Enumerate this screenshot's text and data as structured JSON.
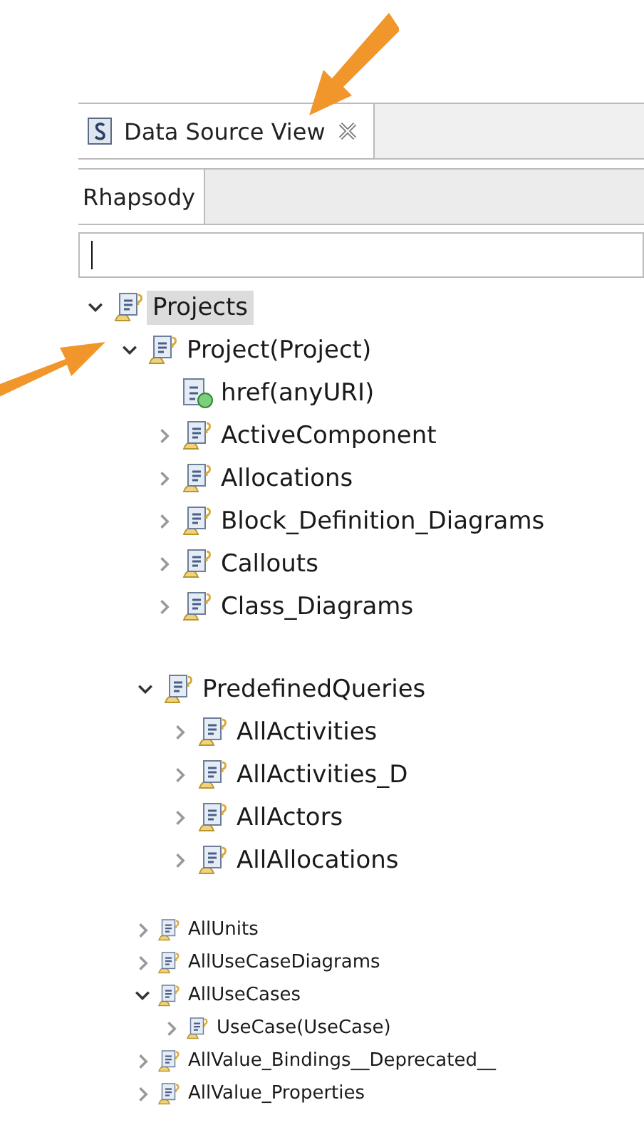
{
  "view": {
    "tabs": [
      {
        "label": "Data Source View",
        "selected": true
      }
    ],
    "subtabs": [
      {
        "label": "Rhapsody",
        "selected": true
      }
    ],
    "tree": [
      {
        "label": "Projects",
        "kind": "element",
        "expanded": true,
        "selected": true,
        "children": [
          {
            "label": "Project(Project)",
            "kind": "element",
            "expanded": true,
            "selected": false,
            "children": [
              {
                "label": "href(anyURI)",
                "kind": "attribute",
                "selected": false
              },
              {
                "label": "ActiveComponent",
                "kind": "element",
                "expanded": false,
                "selected": false
              },
              {
                "label": "Allocations",
                "kind": "element",
                "expanded": false,
                "selected": false
              },
              {
                "label": "Block_Definition_Diagrams",
                "kind": "element",
                "expanded": false,
                "selected": false
              },
              {
                "label": "Callouts",
                "kind": "element",
                "expanded": false,
                "selected": false
              },
              {
                "label": "Class_Diagrams",
                "kind": "element",
                "expanded": false,
                "selected": false
              }
            ]
          }
        ]
      }
    ]
  },
  "clips": [
    {
      "kind": "large",
      "tree": [
        {
          "label": "PredefinedQueries",
          "kind": "element",
          "expanded": true,
          "selected": false,
          "children": [
            {
              "label": "AllActivities",
              "kind": "element",
              "expanded": false,
              "selected": false
            },
            {
              "label": "AllActivities_D",
              "kind": "element",
              "expanded": false,
              "selected": false
            },
            {
              "label": "AllActors",
              "kind": "element",
              "expanded": false,
              "selected": false
            },
            {
              "label": "AllAllocations",
              "kind": "element",
              "expanded": false,
              "selected": false
            }
          ]
        }
      ]
    },
    {
      "kind": "small",
      "tree": [
        {
          "label": "AllUnits",
          "kind": "element",
          "expanded": false,
          "selected": false
        },
        {
          "label": "AllUseCaseDiagrams",
          "kind": "element",
          "expanded": false,
          "selected": false
        },
        {
          "label": "AllUseCases",
          "kind": "element",
          "expanded": true,
          "selected": false,
          "children": [
            {
              "label": "UseCase(UseCase)",
              "kind": "element",
              "expanded": false,
              "selected": false
            }
          ]
        },
        {
          "label": "AllValue_Bindings__Deprecated__",
          "kind": "element",
          "expanded": false,
          "selected": false
        },
        {
          "label": "AllValue_Properties",
          "kind": "element",
          "expanded": false,
          "selected": false
        }
      ]
    }
  ]
}
